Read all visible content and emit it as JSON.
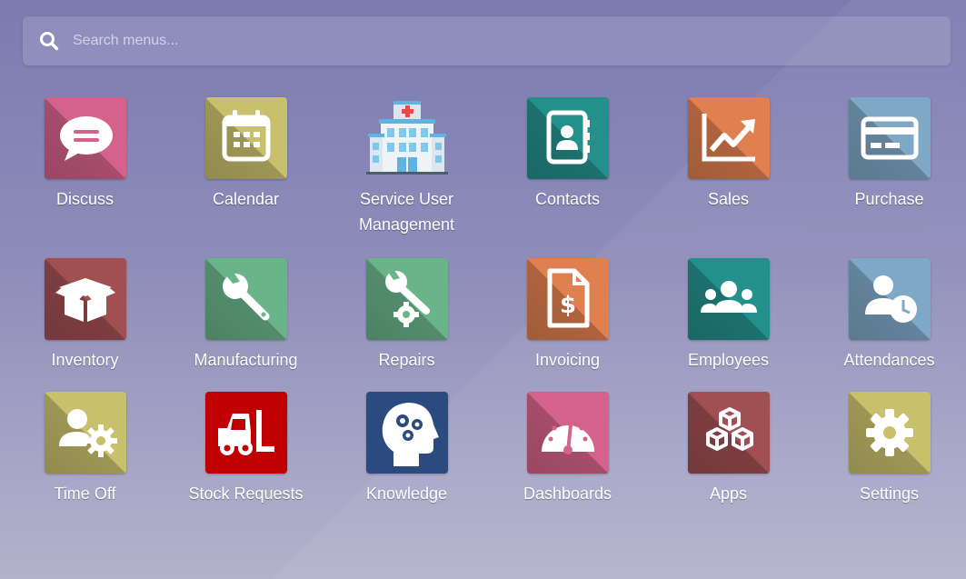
{
  "search": {
    "placeholder": "Search menus...",
    "icon": "search-icon"
  },
  "apps": [
    {
      "label": "Discuss",
      "icon": "speech-bubble-icon",
      "color": "#d5628a"
    },
    {
      "label": "Calendar",
      "icon": "calendar-icon",
      "color": "#c9c06d"
    },
    {
      "label": "Service User Management",
      "icon": "hospital-building-icon",
      "color": ""
    },
    {
      "label": "Contacts",
      "icon": "address-book-icon",
      "color": "#24908c"
    },
    {
      "label": "Sales",
      "icon": "trend-chart-icon",
      "color": "#e07f4f"
    },
    {
      "label": "Purchase",
      "icon": "credit-card-icon",
      "color": "#7fa8c6"
    },
    {
      "label": "Inventory",
      "icon": "open-box-icon",
      "color": "#a04f53"
    },
    {
      "label": "Manufacturing",
      "icon": "wrench-icon",
      "color": "#6ab48a"
    },
    {
      "label": "Repairs",
      "icon": "wrench-gear-icon",
      "color": "#6ab48a"
    },
    {
      "label": "Invoicing",
      "icon": "invoice-dollar-icon",
      "color": "#e07f4f"
    },
    {
      "label": "Employees",
      "icon": "people-group-icon",
      "color": "#24908c"
    },
    {
      "label": "Attendances",
      "icon": "user-clock-icon",
      "color": "#7fa8c6"
    },
    {
      "label": "Time Off",
      "icon": "user-gear-icon",
      "color": "#c9c06d"
    },
    {
      "label": "Stock Requests",
      "icon": "forklift-icon",
      "color": "#c00000"
    },
    {
      "label": "Knowledge",
      "icon": "head-gears-icon",
      "color": "#2b4a80"
    },
    {
      "label": "Dashboards",
      "icon": "speedometer-icon",
      "color": "#d5628a"
    },
    {
      "label": "Apps",
      "icon": "cubes-icon",
      "color": "#a04f53"
    },
    {
      "label": "Settings",
      "icon": "gear-icon",
      "color": "#c9c06d"
    }
  ]
}
